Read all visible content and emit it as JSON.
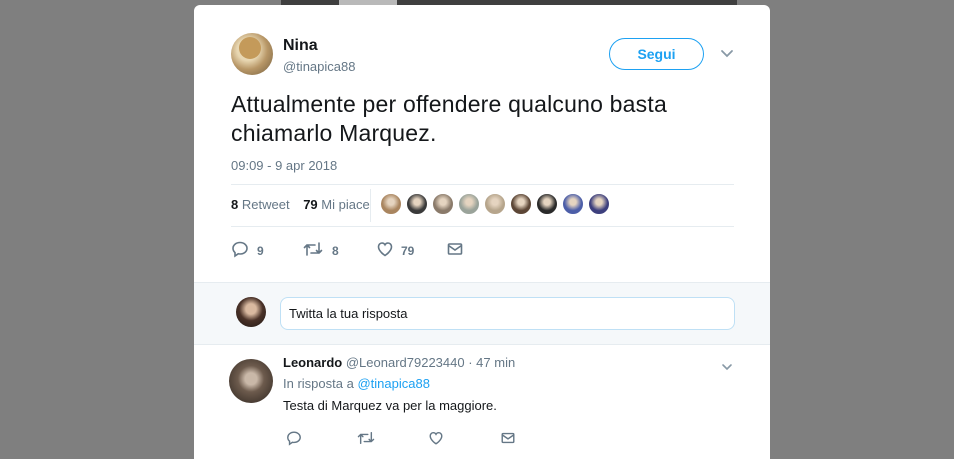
{
  "tweet": {
    "author_name": "Nina",
    "author_handle": "@tinapica88",
    "follow_label": "Segui",
    "text": "Attualmente per offendere qualcuno basta chiamarlo Marquez.",
    "timestamp": "09:09 - 9 apr 2018",
    "stats": {
      "retweet_count": "8",
      "retweet_label": "Retweet",
      "like_count": "79",
      "like_label": "Mi piace"
    },
    "liker_colors": [
      "#a9855f",
      "#3a3a3a",
      "#8a7a6a",
      "#9aa39a",
      "#b6a58c",
      "#5c4636",
      "#2a2a2a",
      "#4c5ea8",
      "#3d3f7d"
    ],
    "actions": {
      "reply_count": "9",
      "retweet_count": "8",
      "like_count": "79"
    }
  },
  "reply_box": {
    "placeholder": "Twitta la tua risposta"
  },
  "reply": {
    "author_name": "Leonardo",
    "author_handle": "@Leonard79223440",
    "time": "· 47 min",
    "in_reply_prefix": "In risposta a",
    "in_reply_mention": "@tinapica88",
    "text": "Testa di Marquez va per la maggiore."
  },
  "colors": {
    "accent": "#1da1f2",
    "secondary_text": "#657786",
    "primary_text": "#14171a",
    "backdrop": "#7f7f7f"
  }
}
